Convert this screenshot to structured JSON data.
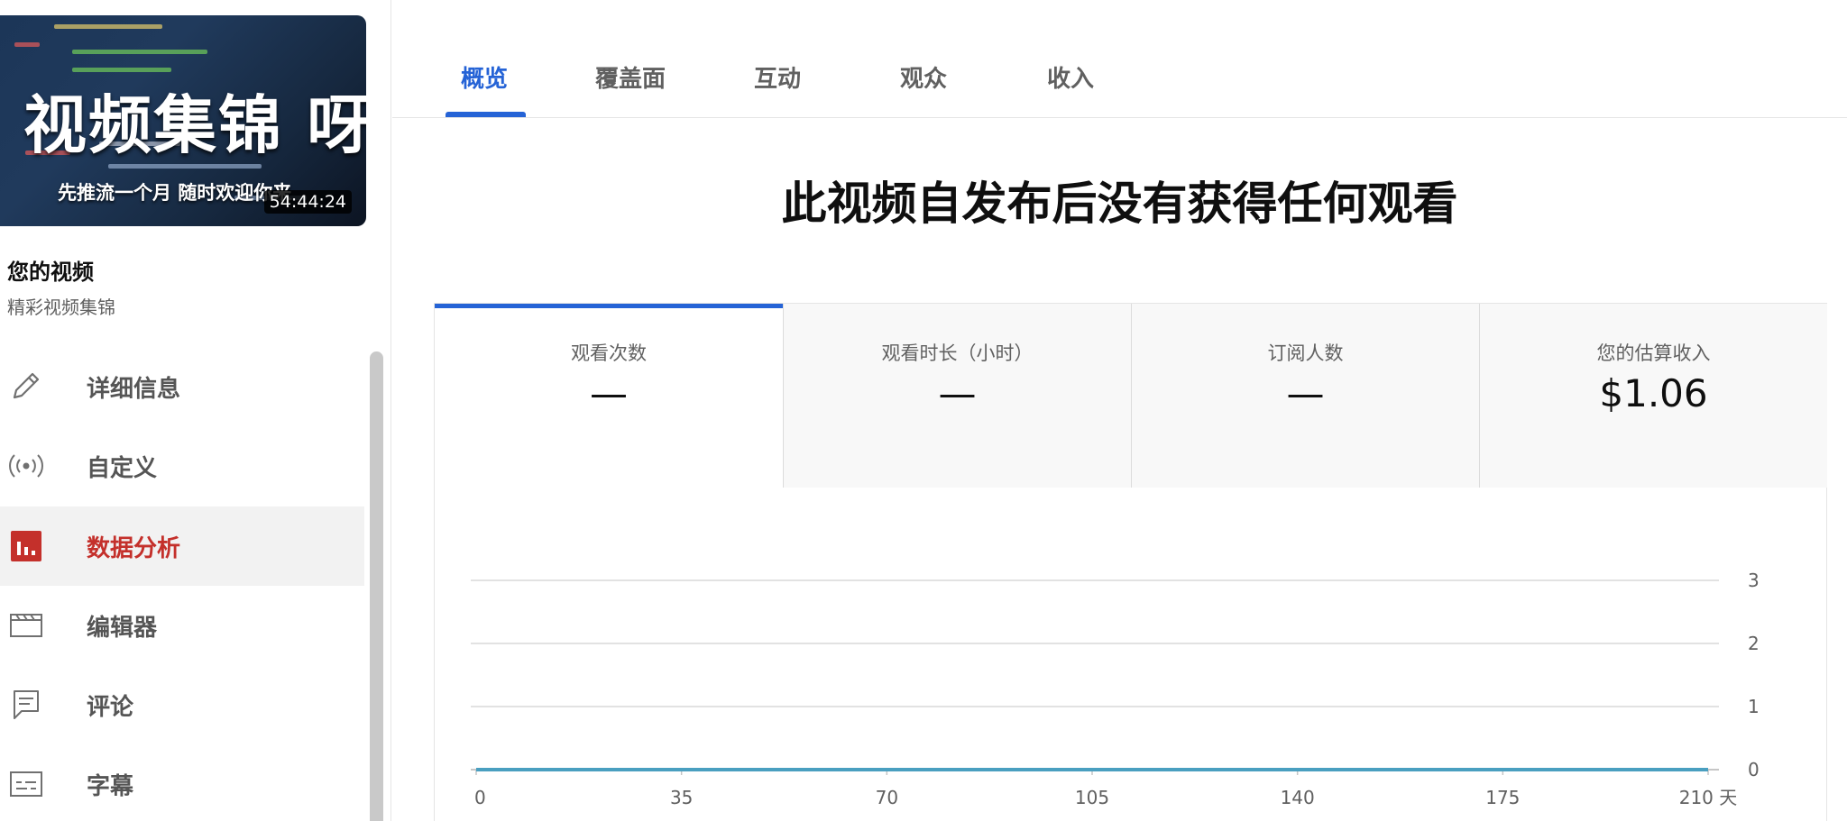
{
  "sidebar": {
    "thumbnail": {
      "title_text": "视频集锦 呀",
      "subtitle_text": "先推流一个月 随时欢迎你来",
      "duration": "54:44:24"
    },
    "channel_title": "您的视频",
    "channel_subtitle": "精彩视频集锦",
    "items": [
      {
        "label": "详细信息",
        "icon": "pencil-icon",
        "active": false
      },
      {
        "label": "自定义",
        "icon": "broadcast-icon",
        "active": false
      },
      {
        "label": "数据分析",
        "icon": "analytics-icon",
        "active": true
      },
      {
        "label": "编辑器",
        "icon": "clapperboard-icon",
        "active": false
      },
      {
        "label": "评论",
        "icon": "comment-icon",
        "active": false
      },
      {
        "label": "字幕",
        "icon": "subtitles-icon",
        "active": false
      }
    ]
  },
  "tabs": [
    {
      "label": "概览",
      "active": true
    },
    {
      "label": "覆盖面",
      "active": false
    },
    {
      "label": "互动",
      "active": false
    },
    {
      "label": "观众",
      "active": false
    },
    {
      "label": "收入",
      "active": false
    }
  ],
  "main": {
    "heading": "此视频自发布后没有获得任何观看"
  },
  "metrics": [
    {
      "label": "观看次数",
      "value": "—",
      "active": true
    },
    {
      "label": "观看时长（小时）",
      "value": "—",
      "active": false
    },
    {
      "label": "订阅人数",
      "value": "—",
      "active": false
    },
    {
      "label": "您的估算收入",
      "value": "$1.06",
      "active": false
    }
  ],
  "colors": {
    "accent": "#2563d6",
    "active_nav": "#c4302b",
    "line": "#4a9fc0"
  },
  "chart_data": {
    "type": "line",
    "x_ticks": [
      "0",
      "35",
      "70",
      "105",
      "140",
      "175",
      "210 天"
    ],
    "y_ticks": [
      "0",
      "1",
      "2",
      "3"
    ],
    "xlim": [
      0,
      210
    ],
    "ylim": [
      0,
      3
    ],
    "series": [
      {
        "x": [
          0,
          210
        ],
        "y": [
          0,
          0
        ]
      }
    ],
    "grid": true
  }
}
